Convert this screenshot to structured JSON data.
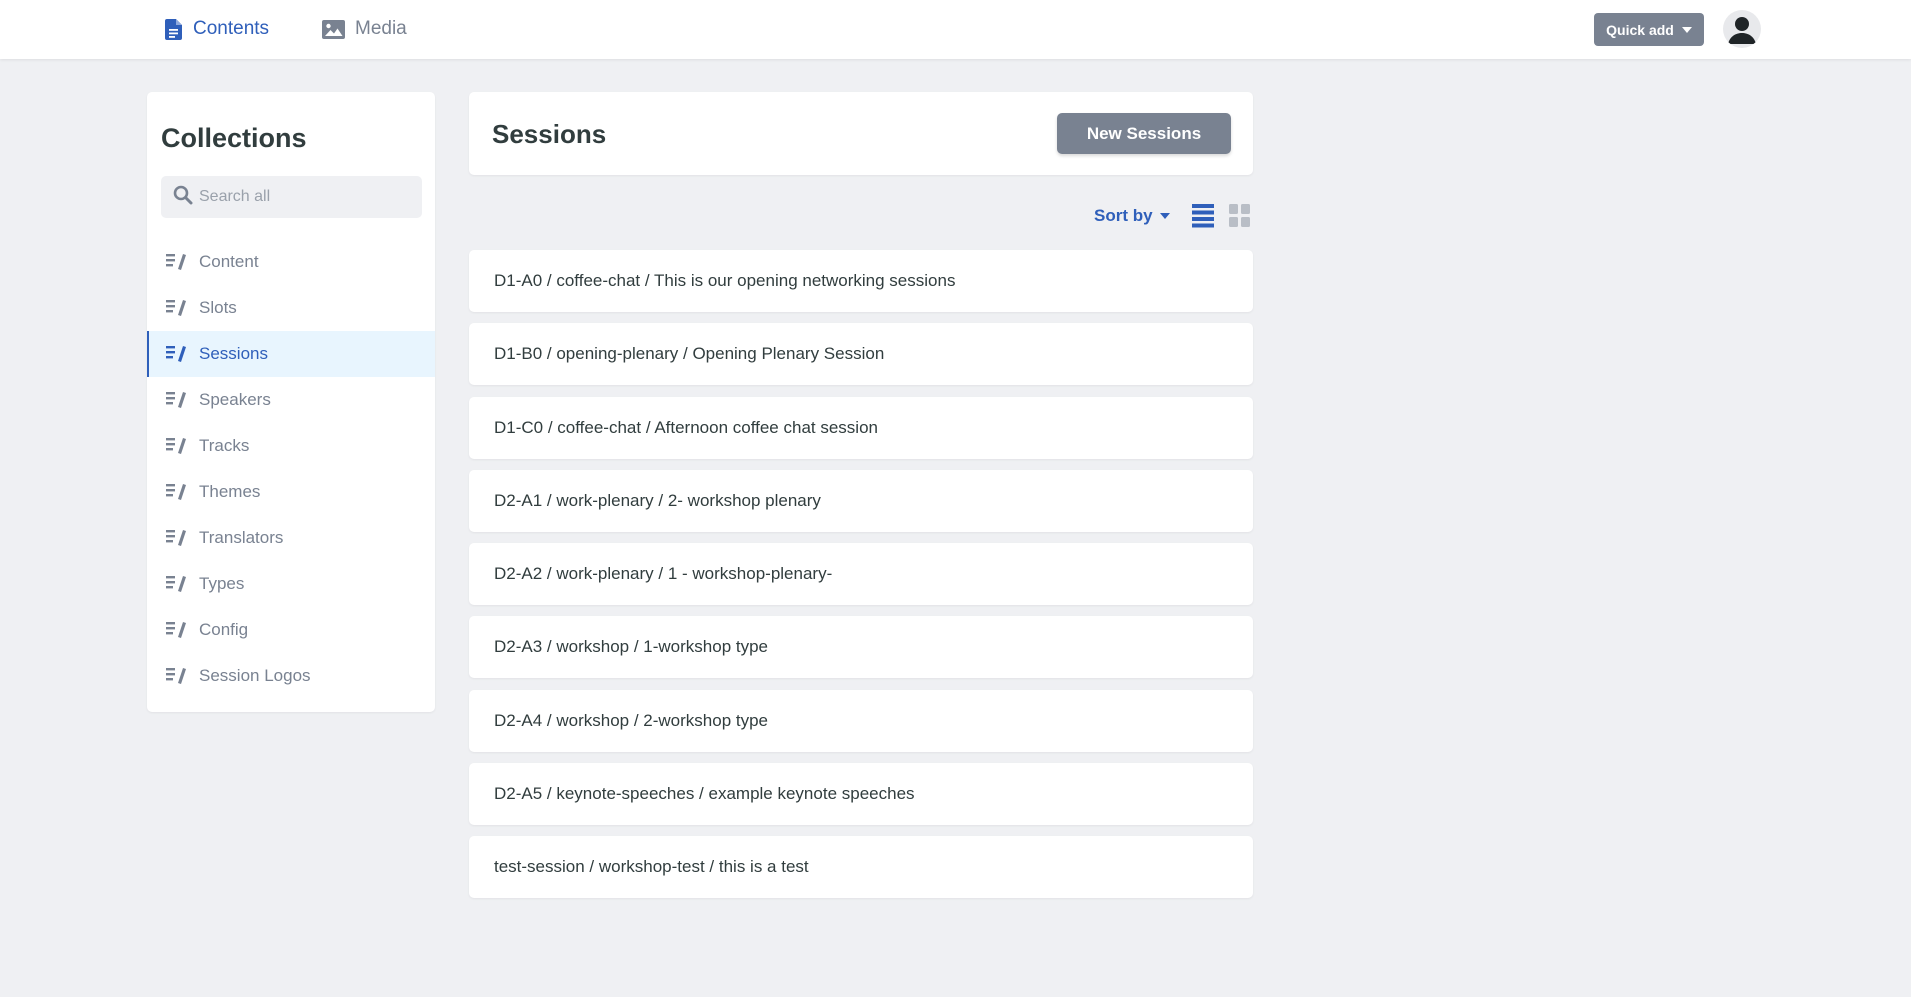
{
  "topbar": {
    "contents_label": "Contents",
    "media_label": "Media",
    "quick_add_label": "Quick add"
  },
  "sidebar": {
    "title": "Collections",
    "search_placeholder": "Search all",
    "items": [
      {
        "label": "Content"
      },
      {
        "label": "Slots"
      },
      {
        "label": "Sessions"
      },
      {
        "label": "Speakers"
      },
      {
        "label": "Tracks"
      },
      {
        "label": "Themes"
      },
      {
        "label": "Translators"
      },
      {
        "label": "Types"
      },
      {
        "label": "Config"
      },
      {
        "label": "Session Logos"
      }
    ],
    "active_item": "Sessions"
  },
  "main": {
    "title": "Sessions",
    "new_button_label": "New Sessions",
    "sort_by_label": "Sort by",
    "entries": [
      "D1-A0 / coffee-chat / This is our opening networking sessions",
      "D1-B0 / opening-plenary / Opening Plenary Session",
      "D1-C0 / coffee-chat / Afternoon coffee chat session",
      "D2-A1 / work-plenary / 2- workshop plenary",
      "D2-A2 / work-plenary / 1 - workshop-plenary-",
      "D2-A3 / workshop / 1-workshop type",
      "D2-A4 / workshop / 2-workshop type",
      "D2-A5 / keynote-speeches / example keynote speeches",
      "test-session / workshop-test / this is a test"
    ]
  },
  "colors": {
    "accent": "#2f5fba",
    "muted": "#798291",
    "background": "#eff0f3",
    "active_bg": "#e8f5fe",
    "text": "#313d3e"
  },
  "icons": {
    "contents": "document-icon",
    "media": "image-icon",
    "search": "search-icon",
    "collection": "write-icon",
    "list_view": "list-view-icon",
    "grid_view": "grid-view-icon",
    "user": "user-avatar-icon"
  }
}
